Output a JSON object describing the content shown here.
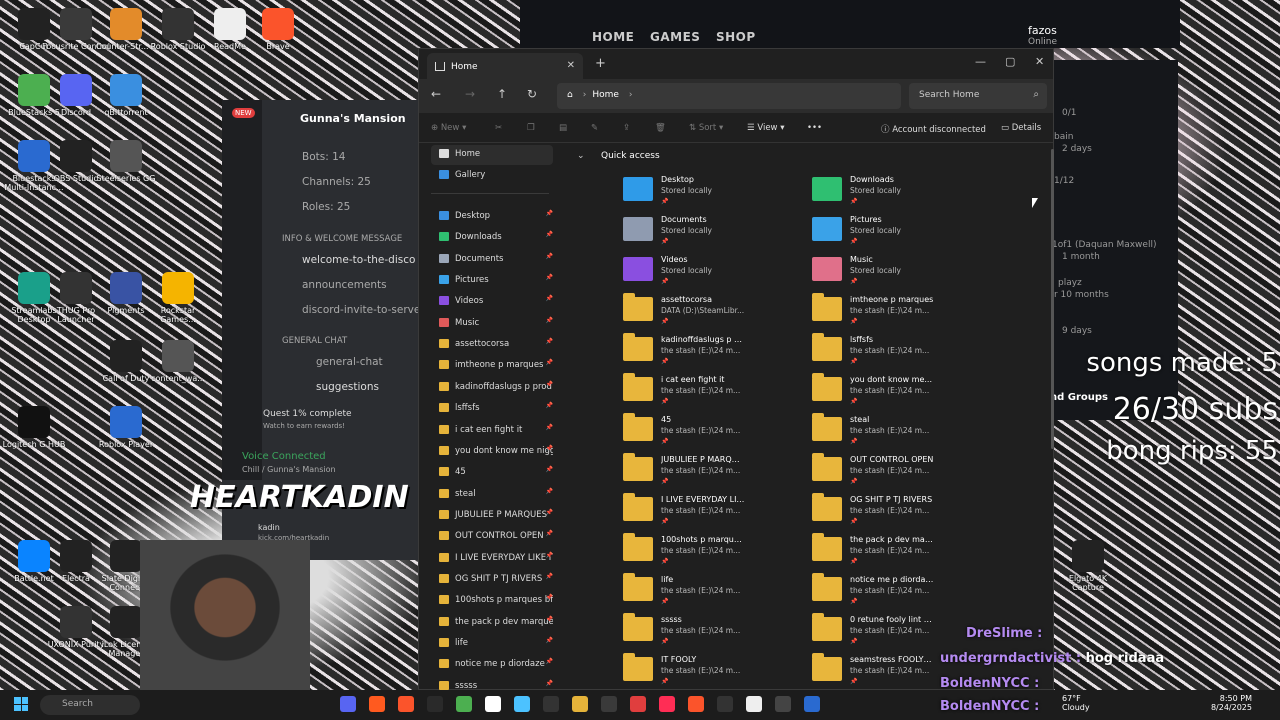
{
  "launcher": {
    "nav": [
      "HOME",
      "GAMES",
      "SHOP"
    ],
    "profile_name": "fazos",
    "profile_status": "Online",
    "side_texts": [
      "0/1",
      "bain",
      "2 days",
      "1/12",
      "1of1 (Daquan Maxwell)",
      "1 month",
      "playz",
      "r 10 months",
      "9 days",
      "nd Groups"
    ]
  },
  "desktop_icons": [
    "CapCut",
    "Focusrite Control",
    "Counter-Str... 2",
    "Roblox Studio",
    "ReadMe",
    "Brave",
    "BlueStacks 5",
    "Discord",
    "qBittorrent",
    "Bluestacks Multi-Instanc...",
    "OBS Studio",
    "Steelseries GG",
    "Streamlabs Desktop",
    "THUG Pro Launcher",
    "Pigments",
    "Rockstar Games...",
    "Call of Duty",
    "content_wa...",
    "Logitech G HUB",
    "Roblox Player",
    "Battle.net",
    "Electra",
    "Slate Digital Connect",
    "UXONIX Purity",
    "iLok License Manager",
    "Ultimate",
    "Elgato 4K Capture"
  ],
  "discord": {
    "server": "Gunna's Mansion",
    "new_badge": "NEW",
    "stats": [
      "Bots: 14",
      "Channels: 25",
      "Roles: 25"
    ],
    "category1": "INFO & WELCOME MESSAGE",
    "channels1": [
      "welcome-to-the-disco",
      "announcements",
      "discord-invite-to-server"
    ],
    "category2": "GENERAL CHAT",
    "channels2": [
      "general-chat",
      "suggestions"
    ],
    "quest_title": "Quest 1% complete",
    "quest_sub": "Watch to earn rewards!",
    "voice": "Voice Connected",
    "voice_sub": "Chill / Gunna's Mansion",
    "user": "kadin",
    "user_sub": "kick.com/heartkadin"
  },
  "explorer": {
    "tab_title": "Home",
    "address": "Home",
    "search_placeholder": "Search Home",
    "cmd": {
      "new": "New",
      "sort": "Sort",
      "view": "View",
      "account": "Account disconnected",
      "details": "Details"
    },
    "sidebar": [
      {
        "label": "Home",
        "color": "#ddd",
        "pin": false,
        "selected": true
      },
      {
        "label": "Gallery",
        "color": "#3a8fe0",
        "pin": false
      },
      {
        "label": "Desktop",
        "color": "#3a8fe0",
        "pin": true
      },
      {
        "label": "Downloads",
        "color": "#2fbf71",
        "pin": true
      },
      {
        "label": "Documents",
        "color": "#9aa6b8",
        "pin": true
      },
      {
        "label": "Pictures",
        "color": "#3aa2e8",
        "pin": true
      },
      {
        "label": "Videos",
        "color": "#8a4fe0",
        "pin": true
      },
      {
        "label": "Music",
        "color": "#e05a5a",
        "pin": true
      },
      {
        "label": "assettocorsa",
        "color": "#e5b33a",
        "pin": true
      },
      {
        "label": "imtheone p marques",
        "color": "#e5b33a",
        "pin": true
      },
      {
        "label": "kadinoffdaslugs p prod",
        "color": "#e5b33a",
        "pin": true
      },
      {
        "label": "lsffsfs",
        "color": "#e5b33a",
        "pin": true
      },
      {
        "label": "i cat een fight it",
        "color": "#e5b33a",
        "pin": true
      },
      {
        "label": "you dont know me nigg",
        "color": "#e5b33a",
        "pin": true
      },
      {
        "label": "45",
        "color": "#e5b33a",
        "pin": true
      },
      {
        "label": "steal",
        "color": "#e5b33a",
        "pin": true
      },
      {
        "label": "JUBULIEE P MARQUES",
        "color": "#e5b33a",
        "pin": true
      },
      {
        "label": "OUT CONTROL OPEN",
        "color": "#e5b33a",
        "pin": true
      },
      {
        "label": "I LIVE EVERYDAY LIKE IT",
        "color": "#e5b33a",
        "pin": true
      },
      {
        "label": "OG SHIT P TJ RIVERS",
        "color": "#e5b33a",
        "pin": true
      },
      {
        "label": "100shots p marques bfc",
        "color": "#e5b33a",
        "pin": true
      },
      {
        "label": "the pack p dev marque",
        "color": "#e5b33a",
        "pin": true
      },
      {
        "label": "life",
        "color": "#e5b33a",
        "pin": true
      },
      {
        "label": "notice me p diordaze",
        "color": "#e5b33a",
        "pin": true
      },
      {
        "label": "sssss",
        "color": "#e5b33a",
        "pin": true
      }
    ],
    "quick_access": "Quick access",
    "tiles": [
      {
        "name": "Desktop",
        "sub": "Stored locally",
        "color": "#2f9be8"
      },
      {
        "name": "Downloads",
        "sub": "Stored locally",
        "color": "#2fbf71"
      },
      {
        "name": "Documents",
        "sub": "Stored locally",
        "color": "#8f9bb0"
      },
      {
        "name": "Pictures",
        "sub": "Stored locally",
        "color": "#3aa2e8"
      },
      {
        "name": "Videos",
        "sub": "Stored locally",
        "color": "#8a4fe0"
      },
      {
        "name": "Music",
        "sub": "Stored locally",
        "color": "#e0708a"
      },
      {
        "name": "assettocorsa",
        "sub": "DATA (D:)\\SteamLibr...",
        "color": "folder"
      },
      {
        "name": "imtheone p marques",
        "sub": "the stash (E:)\\24 m...",
        "color": "folder"
      },
      {
        "name": "kadinoffdaslugs p p...",
        "sub": "the stash (E:)\\24 m...",
        "color": "folder"
      },
      {
        "name": "lsffsfs",
        "sub": "the stash (E:)\\24 m...",
        "color": "folder"
      },
      {
        "name": "i cat een fight it",
        "sub": "the stash (E:)\\24 m...",
        "color": "folder"
      },
      {
        "name": "you dont know me...",
        "sub": "the stash (E:)\\24 m...",
        "color": "folder"
      },
      {
        "name": "45",
        "sub": "the stash (E:)\\24 m...",
        "color": "folder"
      },
      {
        "name": "steal",
        "sub": "the stash (E:)\\24 m...",
        "color": "folder"
      },
      {
        "name": "JUBULIEE P MARQU...",
        "sub": "the stash (E:)\\24 m...",
        "color": "folder"
      },
      {
        "name": "OUT CONTROL OPEN",
        "sub": "the stash (E:)\\24 m...",
        "color": "folder"
      },
      {
        "name": "I LIVE EVERYDAY LIK...",
        "sub": "the stash (E:)\\24 m...",
        "color": "folder"
      },
      {
        "name": "OG SHIT P TJ RIVERS",
        "sub": "the stash (E:)\\24 m...",
        "color": "folder"
      },
      {
        "name": "100shots p marques...",
        "sub": "the stash (E:)\\24 m...",
        "color": "folder"
      },
      {
        "name": "the pack p dev mar...",
        "sub": "the stash (E:)\\24 m...",
        "color": "folder"
      },
      {
        "name": "life",
        "sub": "the stash (E:)\\24 m...",
        "color": "folder"
      },
      {
        "name": "notice me p diordaze",
        "sub": "the stash (E:)\\24 m...",
        "color": "folder"
      },
      {
        "name": "sssss",
        "sub": "the stash (E:)\\24 m...",
        "color": "folder"
      },
      {
        "name": "0 retune fooly lint d...",
        "sub": "the stash (E:)\\24 m...",
        "color": "folder"
      },
      {
        "name": "IT FOOLY",
        "sub": "the stash (E:)\\24 m...",
        "color": "folder"
      },
      {
        "name": "seamstress FOOLY L...",
        "sub": "the stash (E:)\\24 m...",
        "color": "folder"
      }
    ]
  },
  "overlay": {
    "stat1": "songs made: 5",
    "stat2": "26/30 subs",
    "stat3": "bong rips: 55",
    "streamer": "HEARTKADIN",
    "chat": [
      {
        "user": "DreSlime :",
        "msg": ""
      },
      {
        "user": "undergrndactivist :",
        "msg": "hog ridaaa"
      },
      {
        "user": "BoldenNYCC :",
        "msg": ""
      },
      {
        "user": "BoldenNYCC :",
        "msg": ""
      }
    ]
  },
  "taskbar": {
    "search": "Search",
    "weather": "67°F",
    "weather_sub": "Cloudy",
    "time": "8:50 PM",
    "date": "8/24/2025"
  }
}
